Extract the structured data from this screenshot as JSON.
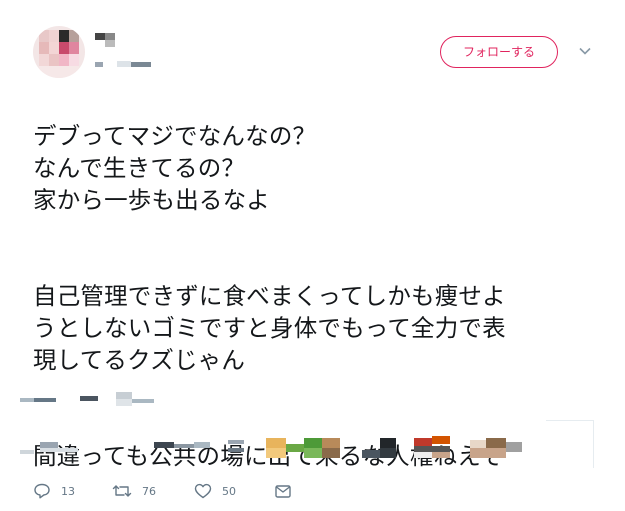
{
  "header": {
    "follow_label": "フォローする",
    "caret_icon": "chevron-down-icon"
  },
  "tweet": {
    "paragraphs": [
      "デブってマジでなんなの？\nなんで生きてるの？\n家から一歩も出るなよ",
      "自己管理できずに食べまくってしかも痩せよ\nうとしないゴミですと身体でもって全力で表\n現してるクズじゃん",
      "間違っても公共の場に出て来るな人権ねえぞ"
    ]
  },
  "actions": {
    "reply": {
      "icon": "reply-icon",
      "count": "13"
    },
    "retweet": {
      "icon": "retweet-icon",
      "count": "76"
    },
    "like": {
      "icon": "heart-icon",
      "count": "50"
    },
    "dm": {
      "icon": "envelope-icon"
    }
  },
  "colors": {
    "accent": "#e0245e",
    "text": "#14171a",
    "muted": "#657786"
  }
}
